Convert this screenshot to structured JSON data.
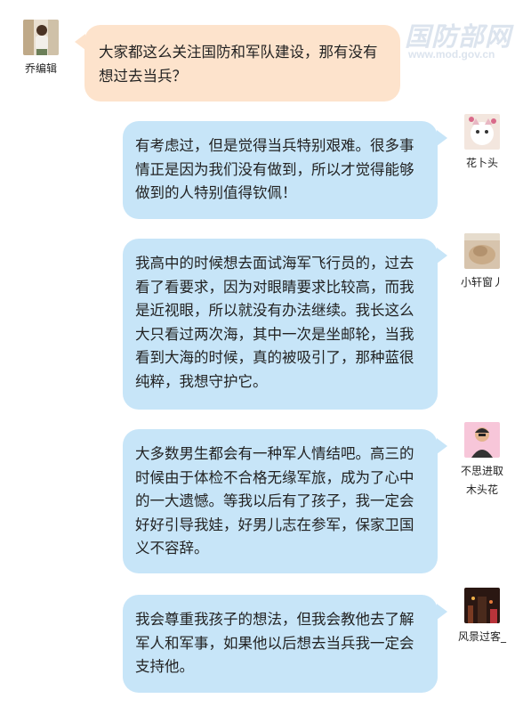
{
  "watermark": {
    "title": "国防部网",
    "url": "www.mod.gov.cn"
  },
  "messages": [
    {
      "user": "乔编辑",
      "side": "left",
      "text": "大家都这么关注国防和军队建设，那有没有想过去当兵？"
    },
    {
      "user": "花卜头",
      "side": "right",
      "text": "有考虑过，但是觉得当兵特别艰难。很多事情正是因为我们没有做到，所以才觉得能够做到的人特别值得钦佩！"
    },
    {
      "user": "小轩窗丿",
      "side": "right",
      "text": "我高中的时候想去面试海军飞行员的，过去看了看要求，因为对眼睛要求比较高，而我是近视眼，所以就没有办法继续。我长这么大只看过两次海，其中一次是坐邮轮，当我看到大海的时候，真的被吸引了，那种蓝很纯粹，我想守护它。"
    },
    {
      "user_line1": "不思进取",
      "user_line2": "木头花",
      "side": "right",
      "text": "大多数男生都会有一种军人情结吧。高三的时候由于体检不合格无缘军旅，成为了心中的一大遗憾。等我以后有了孩子，我一定会好好引导我娃，好男儿志在参军，保家卫国义不容辞。"
    },
    {
      "user": "风景过客_",
      "side": "right",
      "text": "我会尊重我孩子的想法，但我会教他去了解军人和军事，如果他以后想去当兵我一定会支持他。"
    }
  ],
  "colors": {
    "left_bubble": "#fde3cc",
    "right_bubble": "#c7e5f8"
  }
}
